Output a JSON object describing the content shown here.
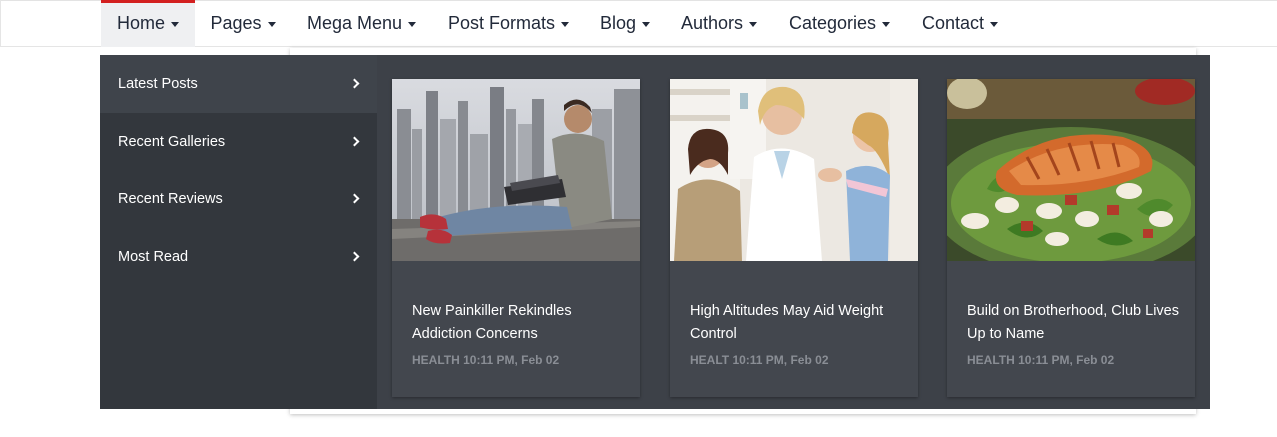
{
  "nav": {
    "items": [
      {
        "label": "Home",
        "active": true
      },
      {
        "label": "Pages"
      },
      {
        "label": "Mega Menu"
      },
      {
        "label": "Post Formats"
      },
      {
        "label": "Blog"
      },
      {
        "label": "Authors"
      },
      {
        "label": "Categories"
      },
      {
        "label": "Contact"
      }
    ]
  },
  "mega": {
    "side_items": [
      {
        "label": "Latest Posts",
        "active": true
      },
      {
        "label": "Recent Galleries"
      },
      {
        "label": "Recent Reviews"
      },
      {
        "label": "Most Read"
      }
    ],
    "posts": [
      {
        "title": "New Painkiller Rekindles Addiction Concerns",
        "meta": "HEALTH 10:11 PM, Feb 02",
        "image": "man-with-laptop-city-photo"
      },
      {
        "title": "High Altitudes May Aid Weight Control",
        "meta": "HEALT 10:11 PM, Feb 02",
        "image": "doctor-with-child-photo"
      },
      {
        "title": "Build on Brotherhood, Club Lives Up to Name",
        "meta": "HEALTH 10:11 PM, Feb 02",
        "image": "salmon-salad-photo"
      }
    ]
  },
  "colors": {
    "accent": "#d32020",
    "nav_text": "#222a3a",
    "mega_bg": "#3d4148",
    "side_bg": "#33373d",
    "card_bg": "#43474e",
    "meta_text": "#8a8e95"
  }
}
